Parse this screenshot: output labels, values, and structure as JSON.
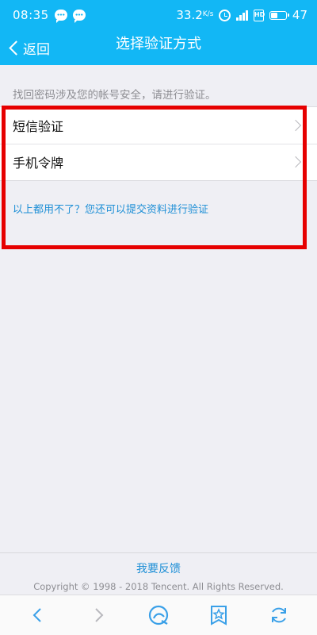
{
  "status_bar": {
    "time": "08:35",
    "speed": "33.2",
    "speed_unit": "K/s",
    "sim_label": "HD",
    "battery": "47"
  },
  "nav": {
    "back_label": "返回",
    "title": "选择验证方式"
  },
  "hint": "找回密码涉及您的帐号安全，请进行验证。",
  "options": [
    {
      "label": "短信验证"
    },
    {
      "label": "手机令牌"
    }
  ],
  "alt_link": "以上都用不了？您还可以提交资料进行验证",
  "footer": {
    "feedback": "我要反馈",
    "copyright": "Copyright © 1998 - 2018 Tencent. All Rights Reserved."
  },
  "colors": {
    "header_blue": "#12b7f5",
    "link_blue": "#1e8fd6",
    "highlight_red": "#e60000",
    "icon_blue": "#3aa0e8"
  },
  "bottom_bar": {
    "icons": [
      "back-arrow-icon",
      "forward-arrow-icon",
      "qq-browser-icon",
      "bookmark-star-icon",
      "refresh-icon"
    ]
  }
}
